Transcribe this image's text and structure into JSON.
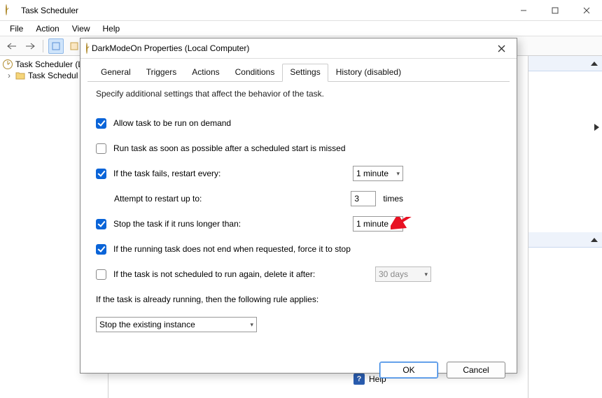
{
  "window": {
    "title": "Task Scheduler",
    "menus": [
      "File",
      "Action",
      "View",
      "Help"
    ]
  },
  "tree": {
    "root": "Task Scheduler (L",
    "child": "Task Schedul"
  },
  "bottom_help": "Help",
  "dialog": {
    "title": "DarkModeOn Properties (Local Computer)",
    "tabs": [
      "General",
      "Triggers",
      "Actions",
      "Conditions",
      "Settings",
      "History (disabled)"
    ],
    "active_tab": "Settings",
    "desc": "Specify additional settings that affect the behavior of the task.",
    "allow_demand": {
      "checked": true,
      "label": "Allow task to be run on demand"
    },
    "run_asap": {
      "checked": false,
      "label": "Run task as soon as possible after a scheduled start is missed"
    },
    "restart": {
      "checked": true,
      "label": "If the task fails, restart every:",
      "interval": "1 minute",
      "attempt_label": "Attempt to restart up to:",
      "attempt_value": "3",
      "attempt_suffix": "times"
    },
    "stop_longer": {
      "checked": true,
      "label": "Stop the task if it runs longer than:",
      "value": "1 minute"
    },
    "force_stop": {
      "checked": true,
      "label": "If the running task does not end when requested, force it to stop"
    },
    "delete_after": {
      "checked": false,
      "label": "If the task is not scheduled to run again, delete it after:",
      "value": "30 days"
    },
    "rule_label": "If the task is already running, then the following rule applies:",
    "rule_value": "Stop the existing instance",
    "ok": "OK",
    "cancel": "Cancel"
  }
}
